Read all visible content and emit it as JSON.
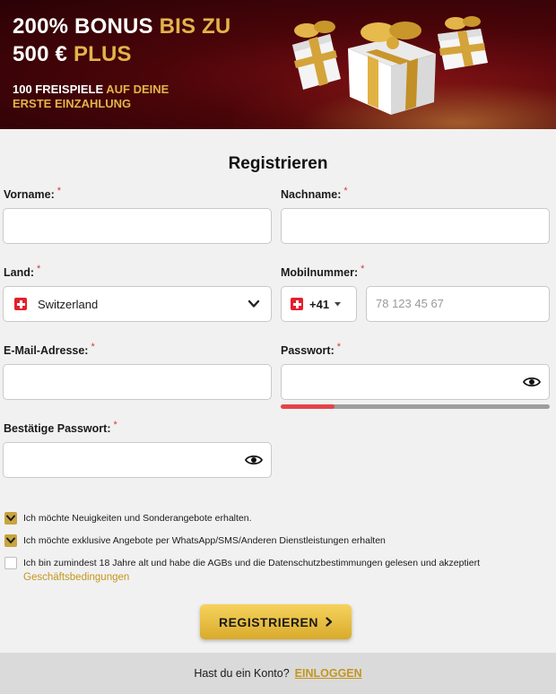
{
  "banner": {
    "line1_white": "200% BONUS ",
    "line1_gold": "BIS ZU",
    "line2_white": "500 € ",
    "line2_gold": "PLUS",
    "sub1_white": "100 FREISPIELE ",
    "sub1_gold": "AUF DEINE",
    "sub2_gold": "ERSTE EINZAHLUNG"
  },
  "form": {
    "title": "Registrieren",
    "required_mark": "*",
    "first_name": {
      "label": "Vorname:",
      "value": ""
    },
    "last_name": {
      "label": "Nachname:",
      "value": ""
    },
    "country": {
      "label": "Land:",
      "value": "Switzerland",
      "flag_icon": "swiss-flag-icon"
    },
    "mobile": {
      "label": "Mobilnummer:",
      "prefix": "+41",
      "placeholder": "78 123 45 67"
    },
    "email": {
      "label": "E-Mail-Adresse:",
      "value": ""
    },
    "password": {
      "label": "Passwort:",
      "value": "",
      "strength": 0.2
    },
    "confirm_password": {
      "label": "Bestätige Passwort:",
      "value": ""
    },
    "checkboxes": [
      {
        "text": "Ich möchte Neuigkeiten und Sonderangebote erhalten.",
        "checked": true
      },
      {
        "text": "Ich möchte exklusive Angebote per WhatsApp/SMS/Anderen Dienstleistungen erhalten",
        "checked": true
      },
      {
        "text": "Ich bin zumindest 18 Jahre alt und habe die AGBs und die Datenschutzbestimmungen gelesen und akzeptiert",
        "checked": false,
        "link": "Geschäftsbedingungen"
      }
    ],
    "submit_label": "REGISTRIEREN"
  },
  "footer": {
    "question": "Hast du ein Konto?",
    "login_label": "EINLOGGEN"
  },
  "colors": {
    "accent": "#e2b44a",
    "banner_red": "#4a0509",
    "strength_red": "#e5434b",
    "required": "#d9363e"
  }
}
